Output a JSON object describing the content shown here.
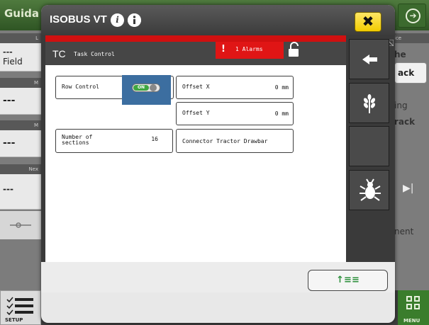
{
  "background": {
    "app_title": "Guida",
    "left_panel": [
      {
        "header": "L",
        "value": "---",
        "sub": "Field"
      },
      {
        "header": "M",
        "value": "---"
      },
      {
        "header": "M",
        "value": "---"
      },
      {
        "header": "Nex",
        "value": "---"
      }
    ],
    "right_panel": {
      "header": "ice",
      "line1": "he",
      "button1": "ack",
      "line2": "ing",
      "line3": "rack",
      "line4": "nent"
    },
    "setup_label": "SETUP",
    "menu_label": "MENU"
  },
  "dialog": {
    "title": "ISOBUS VT",
    "close_label": "✖",
    "vt": {
      "header_code": "TC",
      "header_title": "Task Control",
      "alarm_icon": "!",
      "alarm_text": "1 Alarms",
      "fields": {
        "row_control_label": "Row Control",
        "row_control_toggle": "ON",
        "offset_x_label": "Offset X",
        "offset_x_value": "0 mm",
        "offset_y_label": "Offset Y",
        "offset_y_value": "0 mm",
        "sections_label_1": "Number of",
        "sections_label_2": "sections",
        "sections_value": "16",
        "connector_label": "Connector Tractor Drawbar"
      }
    },
    "softkeys": [
      "arrow-left-icon",
      "grain-icon",
      "empty",
      "bug-icon"
    ],
    "ok_label": "↑≡≡"
  },
  "colors": {
    "accent_green": "#3a7d2c",
    "alarm_red": "#e01515",
    "close_yellow": "#f2cc00",
    "toggle_blue": "#3c6ea0"
  }
}
